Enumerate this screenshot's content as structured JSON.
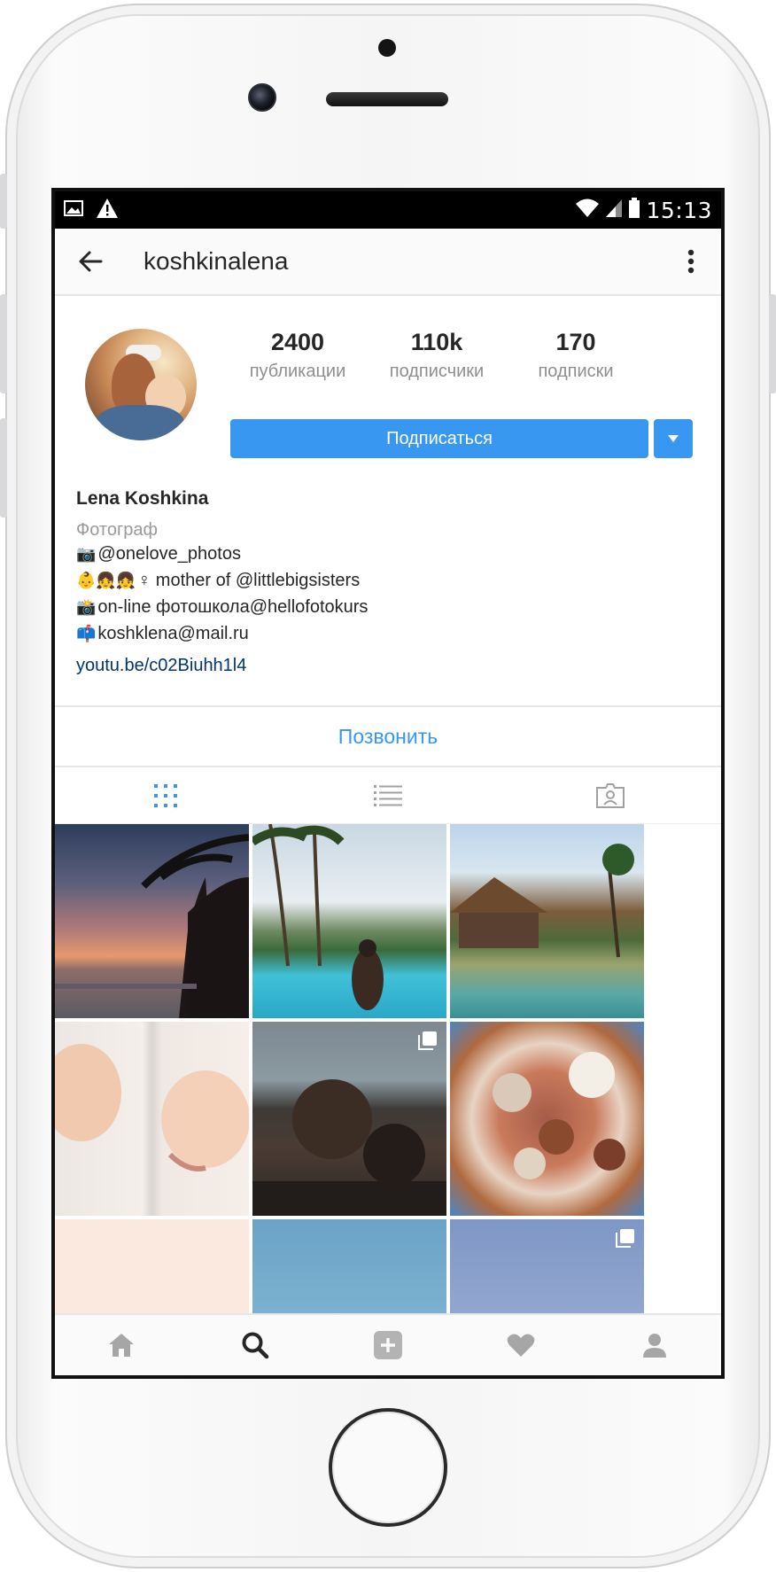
{
  "status_bar": {
    "time": "15:13",
    "icons": [
      "image-icon",
      "warning-icon",
      "wifi-icon",
      "signal-icon",
      "battery-icon"
    ]
  },
  "app_bar": {
    "title": "koshkinalena",
    "back_icon": "arrow-left-icon",
    "menu_icon": "more-vertical-icon"
  },
  "profile": {
    "stats": [
      {
        "value": "2400",
        "label": "публикации"
      },
      {
        "value": "110k",
        "label": "подписчики"
      },
      {
        "value": "170",
        "label": "подписки"
      }
    ],
    "follow_label": "Подписаться",
    "name": "Lena Koshkina",
    "category": "Фотограф",
    "bio_lines": [
      {
        "emoji": "📷",
        "text": "@onelove_photos"
      },
      {
        "emoji": "👶👧👧",
        "text": " ♀ mother of @littlebigsisters"
      },
      {
        "emoji": "📸",
        "text": " on-line фотошкола@hellofotokurs"
      },
      {
        "emoji": "📫",
        "text": " koshklena@mail.ru"
      }
    ],
    "link": "youtu.be/c02Biuhh1l4",
    "call_label": "Позвонить"
  },
  "colors": {
    "accent": "#3897f0",
    "link": "#003569",
    "muted": "#8e8e8e"
  },
  "view_tabs": [
    {
      "name": "grid-view-icon",
      "active": true
    },
    {
      "name": "list-view-icon",
      "active": false
    },
    {
      "name": "tagged-photos-icon",
      "active": false
    }
  ],
  "bottom_nav": [
    "home-icon",
    "search-icon",
    "add-post-icon",
    "heart-icon",
    "profile-icon"
  ]
}
